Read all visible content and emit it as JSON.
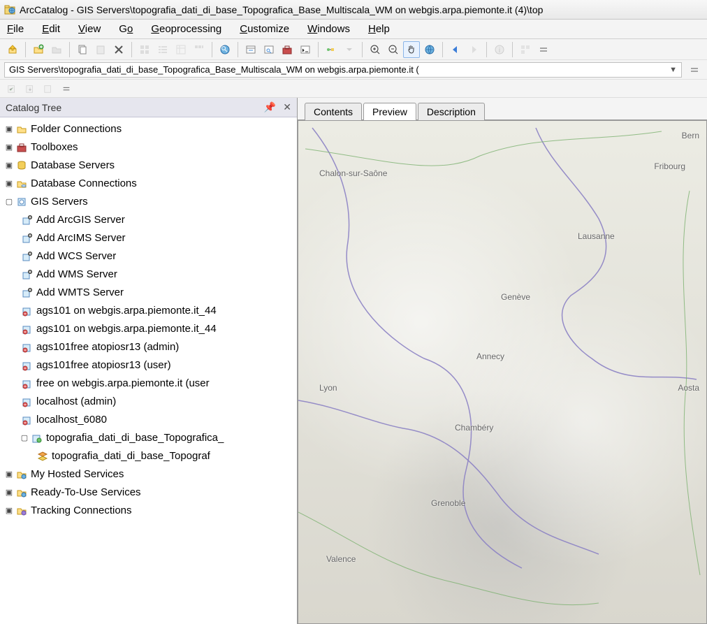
{
  "app": {
    "title": "ArcCatalog - GIS Servers\\topografia_dati_di_base_Topografica_Base_Multiscala_WM on webgis.arpa.piemonte.it (4)\\top"
  },
  "menu": {
    "file": "File",
    "edit": "Edit",
    "view": "View",
    "go": "Go",
    "geoprocessing": "Geoprocessing",
    "customize": "Customize",
    "windows": "Windows",
    "help": "Help"
  },
  "pathbar": {
    "value": "GIS Servers\\topografia_dati_di_base_Topografica_Base_Multiscala_WM on webgis.arpa.piemonte.it ("
  },
  "catalog": {
    "title": "Catalog Tree",
    "nodes": {
      "folder_connections": "Folder Connections",
      "toolboxes": "Toolboxes",
      "database_servers": "Database Servers",
      "database_connections": "Database Connections",
      "gis_servers": "GIS Servers",
      "add_arcgis_server": "Add ArcGIS Server",
      "add_arcims_server": "Add ArcIMS Server",
      "add_wcs_server": "Add WCS Server",
      "add_wms_server": "Add WMS Server",
      "add_wmts_server": "Add WMTS Server",
      "ags101_1": "ags101 on webgis.arpa.piemonte.it_44",
      "ags101_2": "ags101 on webgis.arpa.piemonte.it_44",
      "ags101free_admin": "ags101free atopiosr13 (admin)",
      "ags101free_user": "ags101free atopiosr13 (user)",
      "free_webgis": "free on webgis.arpa.piemonte.it (user",
      "localhost_admin": "localhost (admin)",
      "localhost_6080": "localhost_6080",
      "topografia_conn": "topografia_dati_di_base_Topografica_",
      "topografia_layer": "topografia_dati_di_base_Topograf",
      "my_hosted": "My Hosted Services",
      "ready_to_use": "Ready-To-Use Services",
      "tracking": "Tracking Connections"
    }
  },
  "tabs": {
    "contents": "Contents",
    "preview": "Preview",
    "description": "Description"
  },
  "map_labels": {
    "chalon": "Chalon-sur-Saône",
    "fribourg": "Fribourg",
    "lausanne": "Lausanne",
    "geneve": "Genève",
    "annecy": "Annecy",
    "lyon": "Lyon",
    "chambery": "Chambéry",
    "aosta": "Aosta",
    "grenoble": "Grenoble",
    "valence": "Valence",
    "bern": "Bern"
  }
}
